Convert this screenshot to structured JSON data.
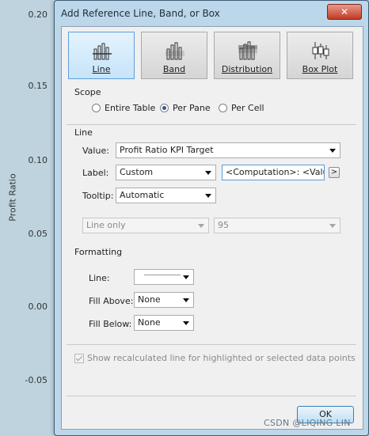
{
  "axis": {
    "title": "Profit Ratio",
    "ticks": [
      "0.20",
      "0.15",
      "0.10",
      "0.05",
      "0.00",
      "-0.05"
    ]
  },
  "dialog": {
    "title": "Add Reference Line, Band, or Box",
    "close_icon": "close-x-icon",
    "modes": [
      {
        "label": "Line",
        "icon": "line-chart-icon",
        "selected": true
      },
      {
        "label": "Band",
        "icon": "band-chart-icon",
        "selected": false
      },
      {
        "label": "Distribution",
        "icon": "distribution-chart-icon",
        "selected": false
      },
      {
        "label": "Box Plot",
        "icon": "box-plot-icon",
        "selected": false
      }
    ],
    "scope": {
      "title": "Scope",
      "options": [
        {
          "label": "Entire Table",
          "selected": false
        },
        {
          "label": "Per Pane",
          "selected": true
        },
        {
          "label": "Per Cell",
          "selected": false
        }
      ]
    },
    "line": {
      "title": "Line",
      "value_label": "Value:",
      "value": "Profit Ratio KPI Target",
      "label_label": "Label:",
      "label_value": "Custom",
      "label_text": "<Computation>: <Value>",
      "insert_button": ">",
      "tooltip_label": "Tooltip:",
      "tooltip_value": "Automatic",
      "line_only": "Line only",
      "confidence": "95"
    },
    "formatting": {
      "title": "Formatting",
      "line_label": "Line:",
      "fill_above_label": "Fill Above:",
      "fill_above_value": "None",
      "fill_below_label": "Fill Below:",
      "fill_below_value": "None"
    },
    "recalc_checkbox": "Show recalculated line for highlighted or selected data points",
    "ok_button": "OK",
    "colors": {
      "accent": "#5f9ed6",
      "close": "#c23b23"
    }
  },
  "watermark": "CSDN @LIQING LIN"
}
